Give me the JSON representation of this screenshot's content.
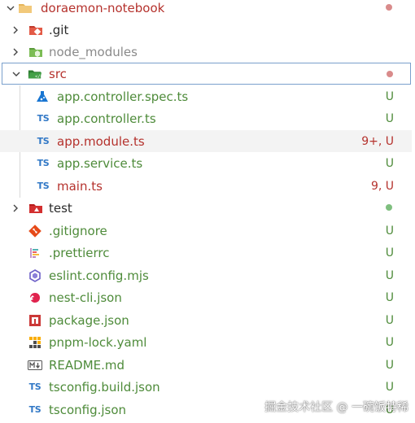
{
  "colors": {
    "untracked": "#4e8b3a",
    "modified_text": "#b5322d",
    "error_count": "#b5322d",
    "dot_red": "#d98b8b",
    "dot_green": "#7fbf7f",
    "gray_text": "#8a8a8a",
    "default_text": "#2b2b2b",
    "selection_border": "#7aa0cc"
  },
  "explorer": {
    "root": {
      "label": "doraemon-notebook",
      "icon": "folder-icon",
      "decoration": "dot-red"
    },
    "items": [
      {
        "label": ".git",
        "icon": "git-folder-icon",
        "kind": "folder",
        "collapsed": true,
        "status": ""
      },
      {
        "label": "node_modules",
        "icon": "node-folder-icon",
        "kind": "folder",
        "collapsed": true,
        "status": ""
      },
      {
        "label": "src",
        "icon": "src-folder-icon",
        "kind": "folder",
        "collapsed": false,
        "decoration": "dot-red"
      },
      {
        "label": "app.controller.spec.ts",
        "icon": "test-icon",
        "kind": "file",
        "status": "U"
      },
      {
        "label": "app.controller.ts",
        "icon": "ts-icon",
        "kind": "file",
        "status": "U"
      },
      {
        "label": "app.module.ts",
        "icon": "ts-icon",
        "kind": "file",
        "status": "9+, U"
      },
      {
        "label": "app.service.ts",
        "icon": "ts-icon",
        "kind": "file",
        "status": "U"
      },
      {
        "label": "main.ts",
        "icon": "ts-icon",
        "kind": "file",
        "status": "9, U"
      },
      {
        "label": "test",
        "icon": "test-folder-icon",
        "kind": "folder",
        "collapsed": true,
        "decoration": "dot-green"
      },
      {
        "label": ".gitignore",
        "icon": "git-icon",
        "kind": "file",
        "status": "U"
      },
      {
        "label": ".prettierrc",
        "icon": "prettier-icon",
        "kind": "file",
        "status": "U"
      },
      {
        "label": "eslint.config.mjs",
        "icon": "eslint-icon",
        "kind": "file",
        "status": "U"
      },
      {
        "label": "nest-cli.json",
        "icon": "nest-icon",
        "kind": "file",
        "status": "U"
      },
      {
        "label": "package.json",
        "icon": "npm-icon",
        "kind": "file",
        "status": "U"
      },
      {
        "label": "pnpm-lock.yaml",
        "icon": "pnpm-icon",
        "kind": "file",
        "status": "U"
      },
      {
        "label": "README.md",
        "icon": "markdown-icon",
        "kind": "file",
        "status": "U"
      },
      {
        "label": "tsconfig.build.json",
        "icon": "tsconfig-icon",
        "kind": "file",
        "status": "U"
      },
      {
        "label": "tsconfig.json",
        "icon": "tsconfig-icon",
        "kind": "file",
        "status": "U"
      }
    ]
  },
  "watermark": "掘金技术社区 @ 一碗饭特稀"
}
